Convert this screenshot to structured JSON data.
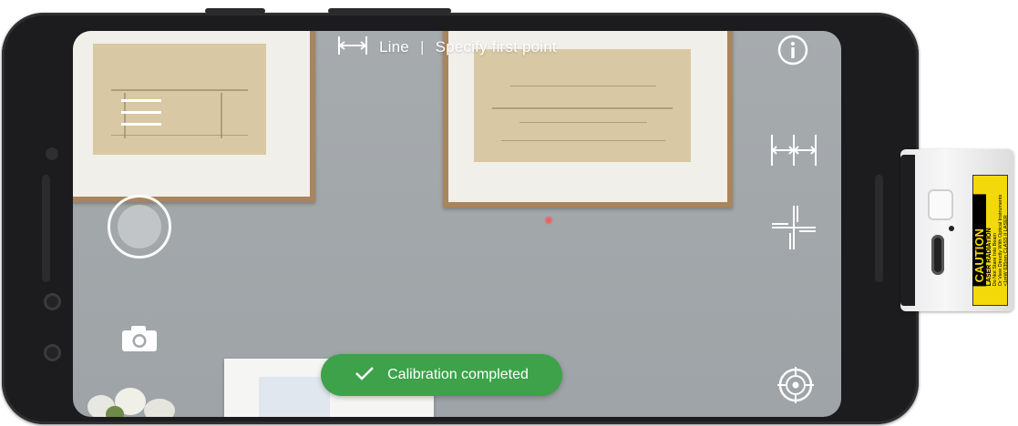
{
  "app": {
    "mode_icon": "line-measure-icon",
    "mode_label": "Line",
    "separator": "|",
    "instruction": "Specify first point"
  },
  "toolbar": {
    "info_icon": "info-icon",
    "menu_icon": "hamburger-menu-icon",
    "line_tool_icon": "multi-segment-line-icon",
    "crosshair_icon": "crosshair-icon",
    "camera_icon": "camera-icon",
    "target_icon": "target-icon"
  },
  "toast": {
    "icon": "checkmark-icon",
    "message": "Calibration completed",
    "color": "#3da24a"
  },
  "device_label": {
    "title": "CAUTION",
    "line1": "LASER RADIATION",
    "line2": "Do Not Stare Into Beam",
    "line3": "Or View Directly With Optical Instruments",
    "line4": "<1mW 635nm CLASS II LASER",
    "color": "#f4d90a"
  }
}
